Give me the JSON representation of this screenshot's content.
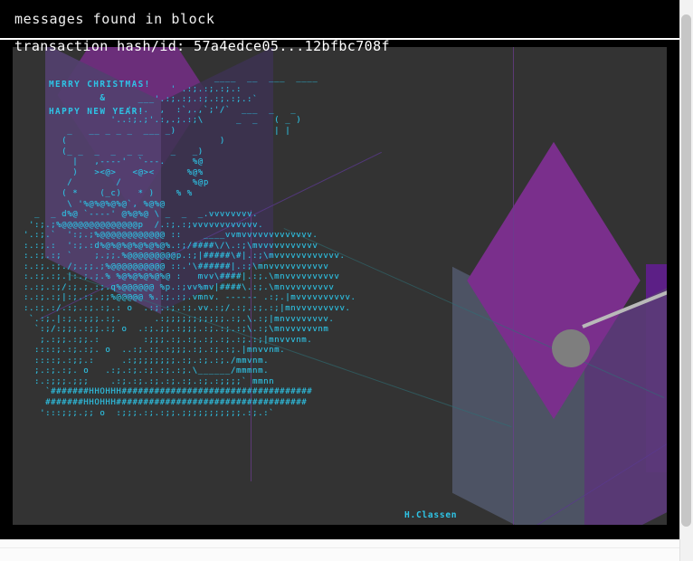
{
  "header": {
    "title": "messages found in block"
  },
  "transaction": {
    "label_line": "transaction hash/id: 57a4edce05...12bfbc708f",
    "hash_prefix": "57a4edce05",
    "hash_suffix": "12bfbc708f",
    "hash_ellipsis": "..."
  },
  "message": {
    "greeting": "MERRY CHRISTMAS!\n        &\nHAPPY NEW YEAR!",
    "signature": "H.Classen",
    "ascii_art": "                                   ____  __  ___  ____\n                           ' .:;.:;.:;.:\n                     ___'.:;.:;.:;.:;.:;.:`\n                  _'.:.  ,  :`,.,`;'/`  ___  _   _\n                '..:;.;'.:,.;.:;\\      _  _   ( _ )\n        _   __ _ _ _  ___ _)                  | |\n       (                            )\n       (_ _  _  _  _ _     _   _)\n         |   ,----'  `---.     %@\n         )   ><@>   <@><      %@%\n        /        /             %@p\n       ( *    (_c)   * )    % %\n        \\ '%@%@%@%@`, %@%@\n  _  _ d%@ `----' @%@%@ \\ _  _  _.vvvvvvvv.\n ':;.;%@@@@@@@@@@@@@@p  /.:;.:;vvvvvvvvvvvv.\n'.:;.`  ':;.;%@@@@@@@@@@@@ ::    ____vvmvvvvvvvvvvvvv.\n:.:;.:  ':;.:d%@%@%@%@%@%@%.:;/####\\/\\.:;\\mvvvvvvvvvvv\n:.:;.:; `    ;.;;.%@@@@@@@@@p.:;|#####\\#|.:;\\mvvvvvvvvvvvv.\n:.:;.:;./;.;;.;%@@@@@@@@@@ ::.'\\######|.:;\\mnvvvvvvvvvvv\n:.:;.:;.|:.;.;.% %@%@%@%@%@ :   mvv\\####|.:;.\\mnvvvvvvvvvv\n:.:;.:;/:;.;.:;.q%@@@@@@ %p.:;vv%mv|####\\.:;.\\mnvvvvvvvvv\n:.:;.:;|:;.:;.;;%@@@@@ %.:;.:;.vmnv. ------ .:;.|mvvvvvvvvvv.\n:.:;.:/.:;.:;.:;.: o  .:;.:;.:;.vv.:;/.:;.:;.:;|mnvvvvvvvvv.\n `.:;.|:;.:;;;.:;.      .:;;;;;;;;;;;.:;.\\.:;|mnvvvvvvvv.\n  `:;/:;;;.:;;.:; o  .:;.;;.:;;;.:;.:;.:;\\.:;\\mnvvvvvvnm\n   ;.:;;.:;;.:        :;;;.:;.:;.:;.:;.:;.:;|mnvvvnm.\n  ::::;.:;.:;. o  ..:;.:;.:;;;.:;.:;.:;.|mnvvnm.\n  ::::;.:;;.:     .:;;;;;;;;.:;.:;.:;./mmvnm.\n  ;.:;.:;. o   .:;.:;.:;.:;.:;.\\______/mmmnm.\n  :.:;;;.;;;    .:;.:;.:;.:;.:;.:;.:;;;;` mmnn\n    `#######HHOHHH###################################\n    #######HHOHHH###################################\n   ':::;;;.;; o  :;;;.:;.:;;.;;;;;;;;;;;.:;.:`",
    "text_color": "#2ec4e6"
  },
  "decor": {
    "canvas_bg": "#333333",
    "purple_top": "#7a2f8c",
    "purple_left": "#53406e",
    "slate_face": "#4f5668",
    "deep_purple": "#5c1f86",
    "knob_color": "#7e7e7e",
    "stick_color": "#b9b9b9"
  },
  "scrollbar": {
    "track_color": "#f2f2f2",
    "thumb_color": "#c6c6c6"
  }
}
